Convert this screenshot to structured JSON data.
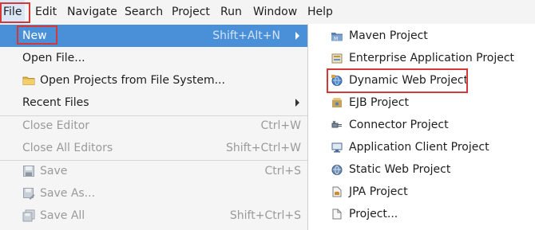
{
  "menubar": [
    "File",
    "Edit",
    "Navigate",
    "Search",
    "Project",
    "Run",
    "Window",
    "Help"
  ],
  "file_menu": {
    "new": {
      "label": "New",
      "accel": "Shift+Alt+N"
    },
    "open_file": {
      "label": "Open File..."
    },
    "open_projects": {
      "label": "Open Projects from File System..."
    },
    "recent_files": {
      "label": "Recent Files"
    },
    "close_editor": {
      "label": "Close Editor",
      "accel": "Ctrl+W"
    },
    "close_all": {
      "label": "Close All Editors",
      "accel": "Shift+Ctrl+W"
    },
    "save": {
      "label": "Save",
      "accel": "Ctrl+S"
    },
    "save_as": {
      "label": "Save As..."
    },
    "save_all": {
      "label": "Save All",
      "accel": "Shift+Ctrl+S"
    }
  },
  "new_submenu": [
    {
      "label": "Maven Project",
      "icon": "maven-project-icon"
    },
    {
      "label": "Enterprise Application Project",
      "icon": "enterprise-app-icon"
    },
    {
      "label": "Dynamic Web Project",
      "icon": "dynamic-web-icon"
    },
    {
      "label": "EJB Project",
      "icon": "ejb-icon"
    },
    {
      "label": "Connector Project",
      "icon": "connector-icon"
    },
    {
      "label": "Application Client Project",
      "icon": "app-client-icon"
    },
    {
      "label": "Static Web Project",
      "icon": "static-web-icon"
    },
    {
      "label": "JPA Project",
      "icon": "jpa-icon"
    },
    {
      "label": "Project...",
      "icon": "project-icon"
    }
  ],
  "colors": {
    "selection": "#4a90d9",
    "highlight_box": "#d23a3a",
    "disabled": "#9a9a9a"
  }
}
